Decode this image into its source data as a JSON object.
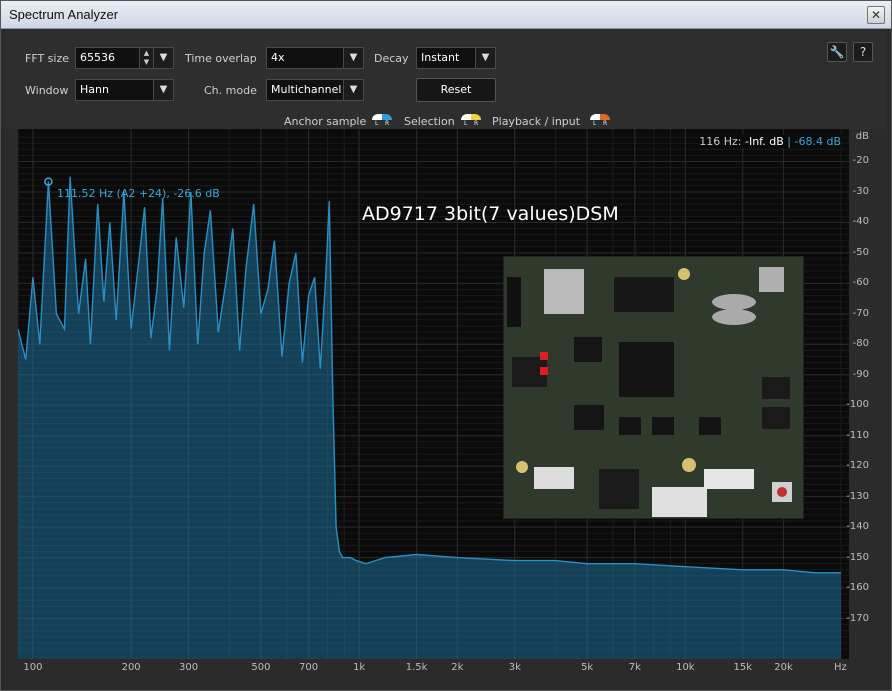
{
  "window": {
    "title": "Spectrum Analyzer",
    "close_glyph": "✕"
  },
  "controls": {
    "fft_size": {
      "label": "FFT size",
      "value": "65536"
    },
    "time_overlap": {
      "label": "Time overlap",
      "value": "4x"
    },
    "decay": {
      "label": "Decay",
      "value": "Instant"
    },
    "window": {
      "label": "Window",
      "value": "Hann"
    },
    "ch_mode": {
      "label": "Ch. mode",
      "value": "Multichannel"
    },
    "reset_label": "Reset",
    "arrow_glyph": "▼",
    "spin_up": "▲",
    "spin_down": "▼",
    "wrench_glyph": "🔧",
    "help_glyph": "?"
  },
  "legend": {
    "anchor_sample": "Anchor sample",
    "selection": "Selection",
    "playback_input": "Playback / input",
    "l": "L",
    "r": "R",
    "colors": {
      "anchor": [
        "#ffffff",
        "#2f9be0"
      ],
      "selection": [
        "#ffffff",
        "#f0d040"
      ],
      "playback": [
        "#ffffff",
        "#e06a20"
      ]
    }
  },
  "readout": {
    "freq": "116 Hz:",
    "left_db": "-Inf. dB",
    "sep": "|",
    "right_db": "-68.4 dB"
  },
  "peak_label": "111.52 Hz (A2 +24), -26.6 dB",
  "overlay_title": "AD9717   3bit(7 values)DSM",
  "colors": {
    "accent": "#3fa5dd",
    "spectrum": "#2a8fc4",
    "background": "#0b0b0b",
    "grid": "#2a2a2a"
  },
  "chart_data": {
    "type": "line",
    "x_scale": "log",
    "xlim": [
      90,
      30000
    ],
    "ylim": [
      -180,
      -10
    ],
    "y_unit": "dB",
    "x_unit": "Hz",
    "x_ticks": [
      {
        "v": 100,
        "t": "100"
      },
      {
        "v": 200,
        "t": "200"
      },
      {
        "v": 300,
        "t": "300"
      },
      {
        "v": 500,
        "t": "500"
      },
      {
        "v": 700,
        "t": "700"
      },
      {
        "v": 1000,
        "t": "1k"
      },
      {
        "v": 1500,
        "t": "1.5k"
      },
      {
        "v": 2000,
        "t": "2k"
      },
      {
        "v": 3000,
        "t": "3k"
      },
      {
        "v": 5000,
        "t": "5k"
      },
      {
        "v": 7000,
        "t": "7k"
      },
      {
        "v": 10000,
        "t": "10k"
      },
      {
        "v": 15000,
        "t": "15k"
      },
      {
        "v": 20000,
        "t": "20k"
      }
    ],
    "x_unit_label": "Hz",
    "y_ticks": [
      -20,
      -30,
      -40,
      -50,
      -60,
      -70,
      -80,
      -90,
      -100,
      -110,
      -120,
      -130,
      -140,
      -150,
      -160,
      -170
    ],
    "y_unit_label": "dB",
    "grid": true,
    "peak_marker": {
      "x": 111.52,
      "y": -26.6
    },
    "series": [
      {
        "x": [
          90,
          95,
          100,
          105,
          111.52,
          118,
          125,
          130,
          138,
          145,
          150,
          158,
          165,
          172,
          180,
          190,
          200,
          210,
          220,
          230,
          240,
          250,
          262,
          275,
          290,
          305,
          320,
          335,
          350,
          370,
          390,
          410,
          430,
          450,
          475,
          500,
          525,
          550,
          580,
          610,
          640,
          670,
          700,
          730,
          760,
          790,
          810,
          830,
          850,
          870,
          890,
          910,
          940,
          980,
          1050,
          1200,
          1500,
          2000,
          3000,
          4000,
          5000,
          7000,
          10000,
          15000,
          20000,
          25000,
          30000
        ],
        "y": [
          -75,
          -85,
          -58,
          -80,
          -26.6,
          -70,
          -75,
          -25,
          -70,
          -52,
          -80,
          -34,
          -66,
          -40,
          -72,
          -30,
          -75,
          -55,
          -35,
          -78,
          -62,
          -32,
          -82,
          -45,
          -68,
          -30,
          -80,
          -50,
          -36,
          -76,
          -60,
          -42,
          -82,
          -55,
          -34,
          -70,
          -62,
          -46,
          -84,
          -60,
          -50,
          -86,
          -64,
          -58,
          -88,
          -58,
          -33,
          -95,
          -140,
          -148,
          -150,
          -150,
          -150,
          -151,
          -152,
          -150,
          -149,
          -150,
          -151,
          -151,
          -152,
          -152,
          -153,
          -154,
          -154,
          -155,
          -155
        ]
      }
    ]
  }
}
